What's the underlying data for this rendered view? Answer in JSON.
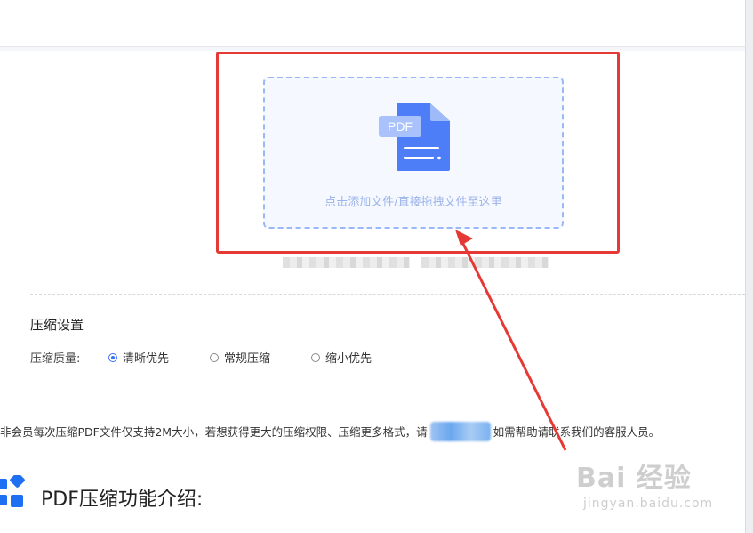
{
  "upload": {
    "icon_label": "PDF",
    "hint": "点击添加文件/直接拖拽文件至这里"
  },
  "settings": {
    "title": "压缩设置",
    "quality_label": "压缩质量:",
    "options": [
      {
        "label": "清晰优先",
        "checked": true
      },
      {
        "label": "常规压缩",
        "checked": false
      },
      {
        "label": "缩小优先",
        "checked": false
      }
    ]
  },
  "notice": {
    "text_before": "非会员每次压缩PDF文件仅支持2M大小，若想获得更大的压缩权限、压缩更多格式，请",
    "text_after": "如需帮助请联系我们的客服人员。"
  },
  "section": {
    "title": "PDF压缩功能介绍:"
  },
  "watermark": {
    "main": "Bai 经验",
    "sub": "jingyan.baidu.com"
  },
  "colors": {
    "accent": "#3a6ff5",
    "annotation": "#e53935",
    "drop_zone_border": "#9ab8f7"
  },
  "icons": [
    "pdf-file-icon",
    "grid-diamond-icon"
  ]
}
